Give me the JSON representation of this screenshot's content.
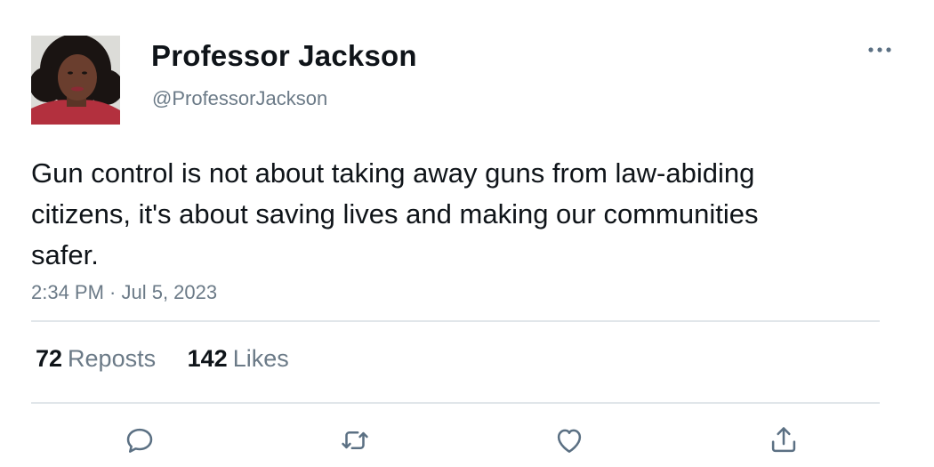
{
  "tweet": {
    "display_name": "Professor Jackson",
    "handle": "@ProfessorJackson",
    "text": "Gun control is not about taking away guns from law-abiding citizens, it's about saving lives and making our communities safer.",
    "timestamp": "2:34 PM · Jul 5, 2023"
  },
  "stats": {
    "reposts_count": "72",
    "reposts_label": "Reposts",
    "likes_count": "142",
    "likes_label": "Likes"
  },
  "icons": {
    "more": "more-options-icon",
    "reply": "reply-icon",
    "repost": "repost-icon",
    "like": "heart-icon",
    "share": "share-icon"
  },
  "colors": {
    "text_primary": "#0f1419",
    "text_secondary": "#6b7a87",
    "divider": "#e1e6ea",
    "icon": "#5b7083"
  }
}
